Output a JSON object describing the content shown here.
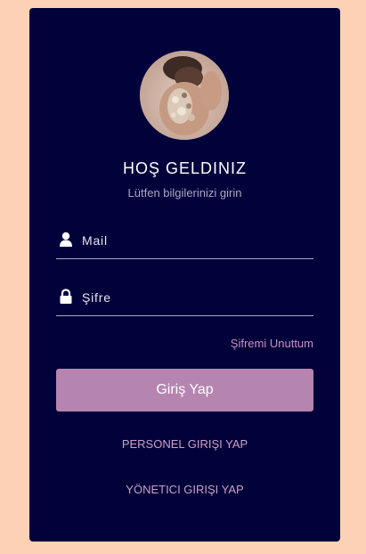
{
  "login": {
    "title": "HOŞ GELDINIZ",
    "subtitle": "Lütfen bilgilerinizi girin",
    "mail_placeholder": "Mail",
    "password_placeholder": "Şifre",
    "forgot_password": "Şifremi Unuttum",
    "submit_label": "Giriş Yap",
    "staff_login": "PERSONEL GIRIŞI YAP",
    "admin_login": "YÖNETICI GIRIŞI YAP"
  },
  "icons": {
    "mail_field": "user-icon",
    "password_field": "lock-icon"
  },
  "colors": {
    "background": "#fdd1b5",
    "card": "#02023a",
    "button": "#b585b0",
    "link": "#c98fbf"
  }
}
